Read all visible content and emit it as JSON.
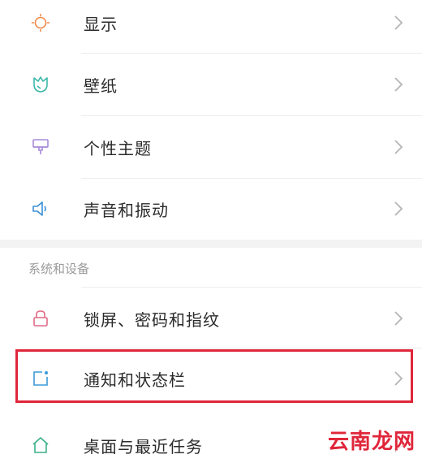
{
  "settings": {
    "items_top": [
      {
        "label": "显示",
        "icon": "sun-icon"
      },
      {
        "label": "壁纸",
        "icon": "tulip-icon"
      },
      {
        "label": "个性主题",
        "icon": "paint-roller-icon"
      },
      {
        "label": "声音和振动",
        "icon": "speaker-icon"
      }
    ],
    "section_title": "系统和设备",
    "items_bottom": [
      {
        "label": "锁屏、密码和指纹",
        "icon": "lock-icon"
      },
      {
        "label": "通知和状态栏",
        "icon": "notification-icon"
      },
      {
        "label": "桌面与最近任务",
        "icon": "home-icon"
      }
    ]
  },
  "watermark": {
    "text": "云南龙网"
  },
  "colors": {
    "highlight": "#e0263a",
    "sun": "#f08a4b",
    "tulip": "#3bb7a8",
    "roller": "#a68ad8",
    "speaker": "#3b8fd6",
    "lock": "#e06a86",
    "notification": "#3b9ad6",
    "home": "#3bb08a"
  }
}
